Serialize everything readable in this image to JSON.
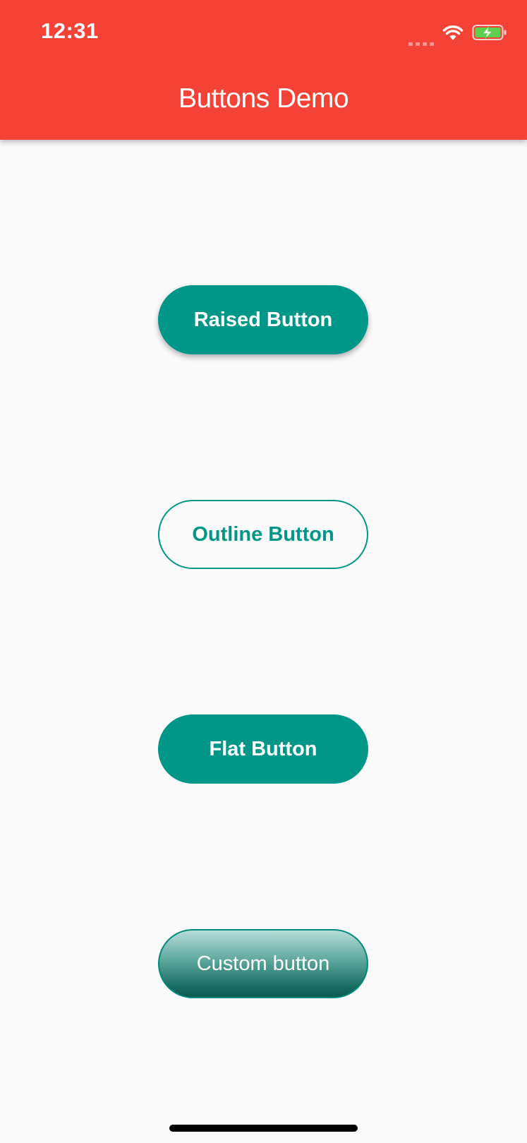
{
  "status_bar": {
    "time": "12:31",
    "signal_icon": "cellular-signal-icon",
    "wifi_icon": "wifi-icon",
    "battery_icon": "battery-charging-icon"
  },
  "app_bar": {
    "title": "Buttons Demo",
    "color": "#f44336"
  },
  "buttons": {
    "raised": {
      "label": "Raised Button",
      "color": "#009688"
    },
    "outline": {
      "label": "Outline Button",
      "color": "#009688"
    },
    "flat": {
      "label": "Flat Button",
      "color": "#009688"
    },
    "custom": {
      "label": "Custom button",
      "color": "#00897b"
    }
  }
}
